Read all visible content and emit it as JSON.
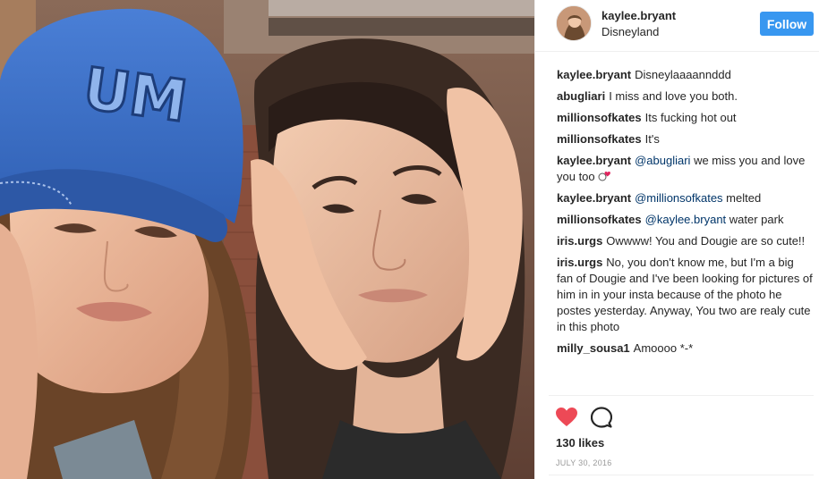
{
  "post": {
    "username": "kaylee.bryant",
    "location": "Disneyland",
    "follow_label": "Follow",
    "hat_text": "UM"
  },
  "comments": [
    {
      "user": "kaylee.bryant",
      "parts": [
        {
          "text": "Disneylaaaannddd",
          "mention": false
        }
      ]
    },
    {
      "user": "abugliari",
      "parts": [
        {
          "text": "I miss and love you both.",
          "mention": false
        }
      ]
    },
    {
      "user": "millionsofkates",
      "parts": [
        {
          "text": "Its fucking hot out",
          "mention": false
        }
      ]
    },
    {
      "user": "millionsofkates",
      "parts": [
        {
          "text": "It's",
          "mention": false
        }
      ]
    },
    {
      "user": "kaylee.bryant",
      "parts": [
        {
          "text": "@abugliari",
          "mention": true
        },
        {
          "text": " we miss you and love you too ",
          "mention": false
        }
      ],
      "emoji": "heart-face-emoji"
    },
    {
      "user": "kaylee.bryant",
      "parts": [
        {
          "text": "@millionsofkates",
          "mention": true
        },
        {
          "text": " melted",
          "mention": false
        }
      ]
    },
    {
      "user": "millionsofkates",
      "parts": [
        {
          "text": "@kaylee.bryant",
          "mention": true
        },
        {
          "text": " water park",
          "mention": false
        }
      ]
    },
    {
      "user": "iris.urgs",
      "parts": [
        {
          "text": "Owwww! You and Dougie are so cute!!",
          "mention": false
        }
      ]
    },
    {
      "user": "iris.urgs",
      "parts": [
        {
          "text": "No, you don't know me, but I'm a big fan of Dougie and I've been looking for pictures of him in in your insta because of the photo he postes yesterday. Anyway, You two are realy cute in this photo",
          "mention": false
        }
      ]
    },
    {
      "user": "milly_sousa1",
      "parts": [
        {
          "text": "Amoooo *-*",
          "mention": false
        }
      ]
    }
  ],
  "actions": {
    "like_icon": "heart-icon",
    "like_color": "#ed4956",
    "comment_icon": "speech-bubble-icon"
  },
  "likes_text": "130 likes",
  "date_text": "JULY 30, 2016",
  "colors": {
    "follow_button": "#3897f0",
    "mention": "#003569",
    "hat": "#3d6fc4"
  }
}
